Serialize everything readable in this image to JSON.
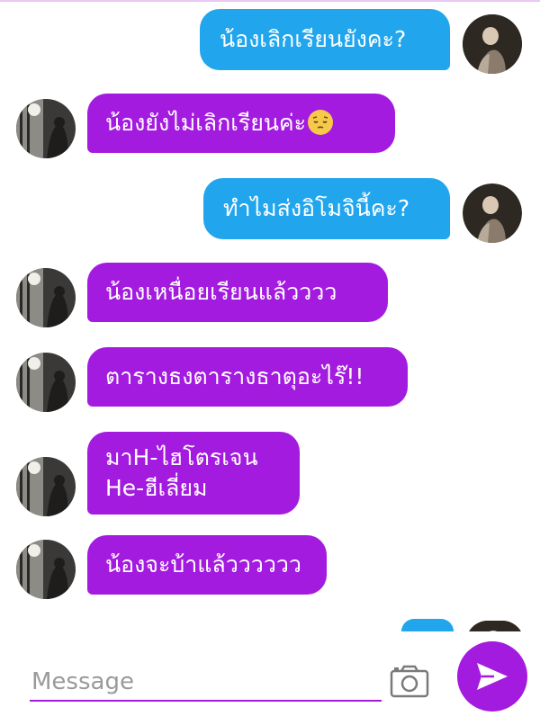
{
  "messages": [
    {
      "side": "out",
      "text": "น้องเลิกเรียนยังคะ?"
    },
    {
      "side": "in",
      "text": "น้องยังไม่เลิกเรียนค่ะ",
      "emoji": "pensive-face"
    },
    {
      "side": "out",
      "text": "ทำไมส่งอิโมจินี้คะ?"
    },
    {
      "side": "in",
      "text": "น้องเหนื่อยเรียนแล้วววว"
    },
    {
      "side": "in",
      "text": "ตารางธงตารางธาตุอะไร๊!!"
    },
    {
      "side": "in",
      "lines": [
        "มาH-ไฮโตรเจน",
        "He-ฮีเลี่ยม"
      ]
    },
    {
      "side": "in",
      "text": "น้องจะบ้าแล้วววววว"
    }
  ],
  "composer": {
    "placeholder": "Message",
    "camera_icon": "camera-icon",
    "send_icon": "send-icon"
  },
  "colors": {
    "outgoing_bubble": "#21a6ee",
    "incoming_bubble": "#a41be0",
    "accent": "#a41be0"
  }
}
